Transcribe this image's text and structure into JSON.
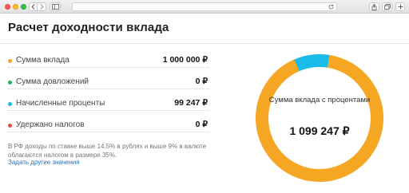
{
  "page": {
    "title": "Расчет доходности вклада"
  },
  "rows": [
    {
      "label": "Сумма вклада",
      "value": "1 000 000 ₽",
      "color": "#f5a623"
    },
    {
      "label": "Сумма довложений",
      "value": "0 ₽",
      "color": "#27ae60"
    },
    {
      "label": "Начисленные проценты",
      "value": "99 247 ₽",
      "color": "#1bbbe8"
    },
    {
      "label": "Удержано налогов",
      "value": "0 ₽",
      "color": "#e74c3c"
    }
  ],
  "note": "В РФ доходы по ставке выше 14.5% в рублях и выше 9% в валюте облагаются налогом в размере 35%.",
  "link_text": "Задать другие значения",
  "summary": {
    "label": "Сумма вклада с процентами",
    "value": "1 099 247 ₽"
  },
  "chart_data": {
    "type": "pie",
    "categories": [
      "Сумма вклада",
      "Сумма довложений",
      "Начисленные проценты",
      "Удержано налогов"
    ],
    "values": [
      1000000,
      0,
      99247,
      0
    ],
    "colors": [
      "#f5a623",
      "#27ae60",
      "#1bbbe8",
      "#e74c3c"
    ]
  },
  "icons": {
    "back": "chevron-left-icon",
    "forward": "chevron-right-icon",
    "sidebar": "sidebar-icon",
    "reload": "reload-icon",
    "share": "share-icon",
    "tabs": "tabs-icon",
    "new_tab": "plus-icon"
  }
}
